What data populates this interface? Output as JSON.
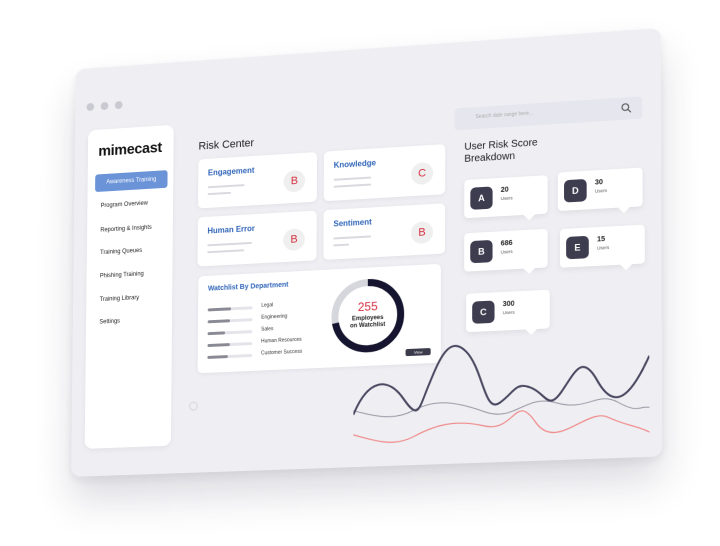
{
  "sidebar": {
    "logo": "mimecast",
    "items": [
      {
        "label": "Awareness Training",
        "active": true
      },
      {
        "label": "Program Overview"
      },
      {
        "label": "Reporting & Insights"
      },
      {
        "label": "Training Queues"
      },
      {
        "label": "Phishing Training"
      },
      {
        "label": "Training Library"
      },
      {
        "label": "Settings"
      }
    ]
  },
  "header": {
    "title": "Risk Center",
    "search_placeholder": "Search date range here..."
  },
  "cards": [
    {
      "title": "Engagement",
      "grade": "B"
    },
    {
      "title": "Knowledge",
      "grade": "C"
    },
    {
      "title": "Human Error",
      "grade": "B"
    },
    {
      "title": "Sentiment",
      "grade": "B"
    }
  ],
  "watchlist": {
    "title": "Watchlist By Department",
    "departments": [
      {
        "name": "Legal",
        "level": 0.52
      },
      {
        "name": "Engineering",
        "level": 0.5
      },
      {
        "name": "Sales",
        "level": 0.4
      },
      {
        "name": "Human Resources",
        "level": 0.5
      },
      {
        "name": "Customer Success",
        "level": 0.46
      }
    ],
    "count": "255",
    "count_label_1": "Employees",
    "count_label_2": "on Watchlist",
    "view_label": "View",
    "donut_fraction": 0.72
  },
  "user_risk": {
    "title_line1": "User Risk Score",
    "title_line2": "Breakdown",
    "scores": [
      {
        "grade": "A",
        "count": "20",
        "unit": "Users"
      },
      {
        "grade": "D",
        "count": "30",
        "unit": "Users"
      },
      {
        "grade": "B",
        "count": "686",
        "unit": "Users"
      },
      {
        "grade": "E",
        "count": "15",
        "unit": "Users"
      },
      {
        "grade": "C",
        "count": "300",
        "unit": "Users"
      }
    ]
  },
  "colors": {
    "accent_blue": "#2f64b8",
    "nav_active": "#6a93d8",
    "grade_red": "#d32f3f",
    "dark": "#3e3c4f",
    "wave_dark": "#4a4860",
    "wave_grey": "#9a9aa6",
    "wave_red": "#f08c8c"
  }
}
